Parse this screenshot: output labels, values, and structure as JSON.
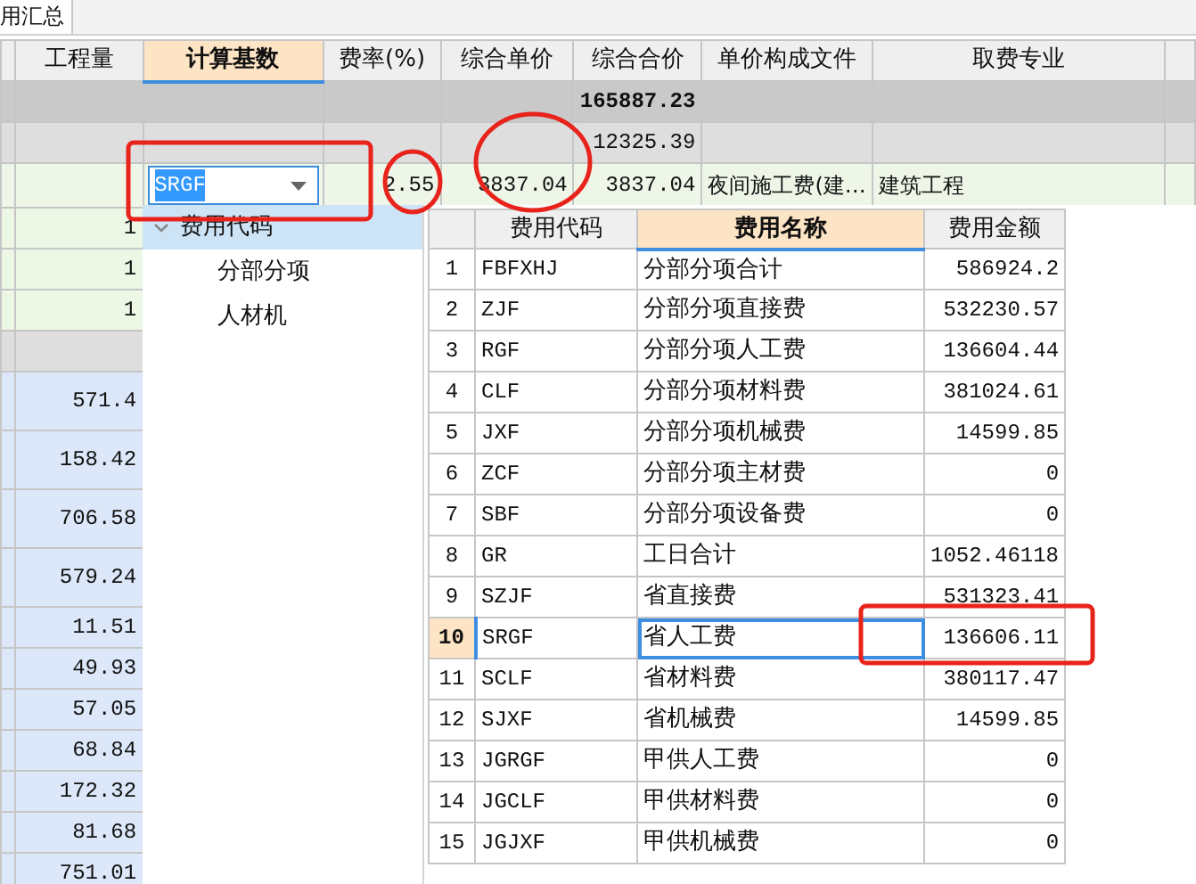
{
  "tab": {
    "label": "用汇总"
  },
  "grid": {
    "columns": [
      {
        "label": "工程量",
        "selected": false
      },
      {
        "label": "计算基数",
        "selected": true
      },
      {
        "label": "费率(%)",
        "selected": false
      },
      {
        "label": "综合单价",
        "selected": false
      },
      {
        "label": "综合合价",
        "selected": false
      },
      {
        "label": "单价构成文件",
        "selected": false
      },
      {
        "label": "取费专业",
        "selected": false
      }
    ],
    "rows": [
      {
        "kind": "group",
        "total": "165887.23"
      },
      {
        "kind": "subgroup",
        "total": "12325.39"
      },
      {
        "kind": "edit",
        "base": "SRGF",
        "base_text_selected": true,
        "rate": "2.55",
        "unit_price": "3837.04",
        "total": "3837.04",
        "price_file": "夜间施工费(建…",
        "specialty": "建筑工程"
      },
      {
        "kind": "item",
        "quantity": "1"
      },
      {
        "kind": "item",
        "quantity": "1"
      },
      {
        "kind": "item",
        "quantity": "1"
      },
      {
        "kind": "subgroup"
      },
      {
        "kind": "detail",
        "quantity": "571.4"
      },
      {
        "kind": "detail",
        "quantity": "158.42"
      },
      {
        "kind": "detail",
        "quantity": "706.58"
      },
      {
        "kind": "detail",
        "quantity": "579.24"
      },
      {
        "kind": "detail",
        "quantity": "11.51"
      },
      {
        "kind": "detail",
        "quantity": "49.93"
      },
      {
        "kind": "detail",
        "quantity": "57.05"
      },
      {
        "kind": "detail",
        "quantity": "68.84"
      },
      {
        "kind": "detail",
        "quantity": "172.32"
      },
      {
        "kind": "detail",
        "quantity": "81.68"
      },
      {
        "kind": "detail",
        "quantity": "751.01"
      }
    ]
  },
  "picker": {
    "tree": [
      {
        "label": "费用代码",
        "expanded": true,
        "selected": true,
        "children": [
          {
            "label": "分部分项",
            "selected": false
          },
          {
            "label": "人材机",
            "selected": false
          }
        ]
      }
    ],
    "table": {
      "columns": [
        {
          "label": "费用代码",
          "selected": false
        },
        {
          "label": "费用名称",
          "selected": true
        },
        {
          "label": "费用金额",
          "selected": false
        }
      ],
      "rows": [
        {
          "index": "1",
          "code": "FBFXHJ",
          "name": "分部分项合计",
          "amount": "586924.2",
          "selected": false
        },
        {
          "index": "2",
          "code": "ZJF",
          "name": "分部分项直接费",
          "amount": "532230.57",
          "selected": false
        },
        {
          "index": "3",
          "code": "RGF",
          "name": "分部分项人工费",
          "amount": "136604.44",
          "selected": false
        },
        {
          "index": "4",
          "code": "CLF",
          "name": "分部分项材料费",
          "amount": "381024.61",
          "selected": false
        },
        {
          "index": "5",
          "code": "JXF",
          "name": "分部分项机械费",
          "amount": "14599.85",
          "selected": false
        },
        {
          "index": "6",
          "code": "ZCF",
          "name": "分部分项主材费",
          "amount": "0",
          "selected": false
        },
        {
          "index": "7",
          "code": "SBF",
          "name": "分部分项设备费",
          "amount": "0",
          "selected": false
        },
        {
          "index": "8",
          "code": "GR",
          "name": "工日合计",
          "amount": "1052.46118",
          "selected": false
        },
        {
          "index": "9",
          "code": "SZJF",
          "name": "省直接费",
          "amount": "531323.41",
          "selected": false
        },
        {
          "index": "10",
          "code": "SRGF",
          "name": "省人工费",
          "amount": "136606.11",
          "selected": true
        },
        {
          "index": "11",
          "code": "SCLF",
          "name": "省材料费",
          "amount": "380117.47",
          "selected": false
        },
        {
          "index": "12",
          "code": "SJXF",
          "name": "省机械费",
          "amount": "14599.85",
          "selected": false
        },
        {
          "index": "13",
          "code": "JGRGF",
          "name": "甲供人工费",
          "amount": "0",
          "selected": false
        },
        {
          "index": "14",
          "code": "JGCLF",
          "name": "甲供材料费",
          "amount": "0",
          "selected": false
        },
        {
          "index": "15",
          "code": "JGJXF",
          "name": "甲供机械费",
          "amount": "0",
          "selected": false
        }
      ]
    }
  },
  "annotations": [
    {
      "kind": "rectangle"
    },
    {
      "kind": "ellipse"
    },
    {
      "kind": "ellipse"
    },
    {
      "kind": "rectangle"
    }
  ]
}
